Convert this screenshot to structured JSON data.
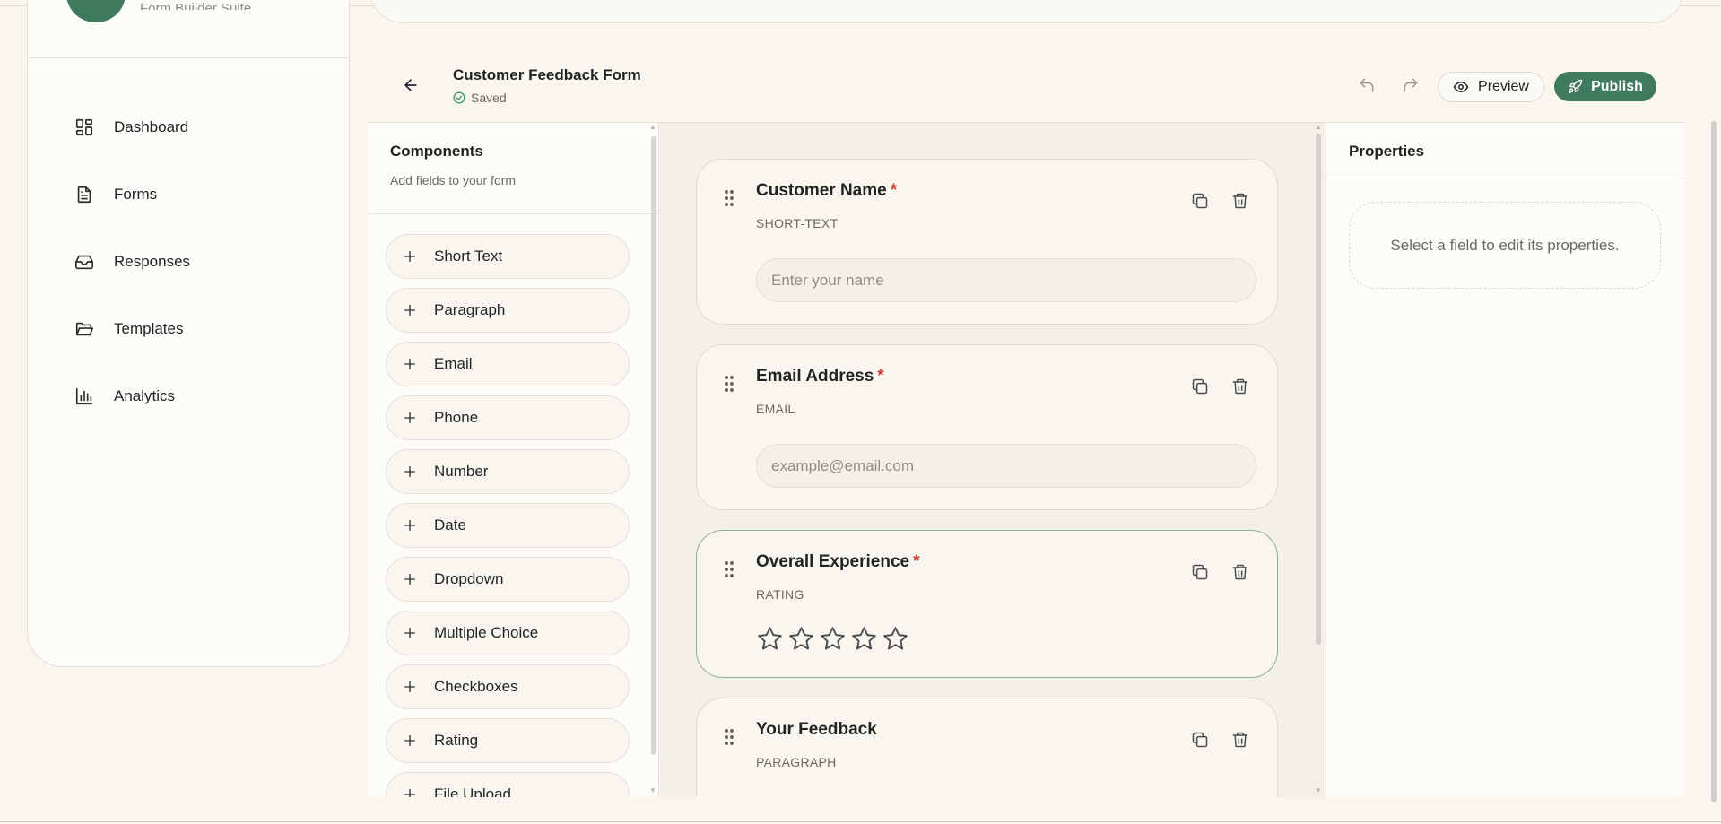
{
  "app": {
    "brand_sub": "Form Builder Suite"
  },
  "sidebar": {
    "items": [
      {
        "label": "Dashboard",
        "icon": "dashboard-icon"
      },
      {
        "label": "Forms",
        "icon": "document-icon"
      },
      {
        "label": "Responses",
        "icon": "inbox-icon"
      },
      {
        "label": "Templates",
        "icon": "folder-icon"
      },
      {
        "label": "Analytics",
        "icon": "bar-chart-icon"
      }
    ]
  },
  "header": {
    "title": "Customer Feedback Form",
    "status": "Saved",
    "preview_label": "Preview",
    "publish_label": "Publish"
  },
  "components": {
    "title": "Components",
    "subtitle": "Add fields to your form",
    "items": [
      "Short Text",
      "Paragraph",
      "Email",
      "Phone",
      "Number",
      "Date",
      "Dropdown",
      "Multiple Choice",
      "Checkboxes",
      "Rating",
      "File Upload"
    ]
  },
  "fields": [
    {
      "label": "Customer Name",
      "required": "*",
      "type": "SHORT-TEXT",
      "placeholder": "Enter your name"
    },
    {
      "label": "Email Address",
      "required": "*",
      "type": "EMAIL",
      "placeholder": "example@email.com"
    },
    {
      "label": "Overall Experience",
      "required": "*",
      "type": "RATING",
      "stars": 5,
      "rating_value": 0
    },
    {
      "label": "Your Feedback",
      "type": "PARAGRAPH"
    }
  ],
  "properties": {
    "title": "Properties",
    "empty_message": "Select a field to edit its properties."
  },
  "colors": {
    "accent": "#3f7a5e",
    "required": "#d33a2c",
    "background": "#f8f6ef"
  }
}
